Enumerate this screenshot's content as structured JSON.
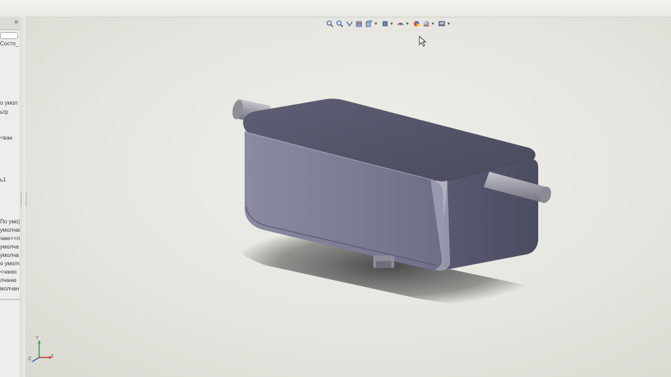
{
  "window": {
    "background_color": "#e7e6e0"
  },
  "feature_tree": {
    "collapse_label": "»",
    "lines": [
      "_Состо",
      "о умол",
      "ьтр",
      "ван>",
      "ь1",
      "(По умо",
      "умолчан",
      "чаю<<п",
      "умолча",
      "умолча",
      "о умолч",
      "чаню>",
      "лчаню",
      "молчан"
    ]
  },
  "heads_up_toolbar": {
    "buttons": [
      {
        "icon": "zoom-to-fit-icon"
      },
      {
        "icon": "zoom-to-area-icon"
      },
      {
        "icon": "previous-view-icon"
      },
      {
        "icon": "section-view-icon"
      },
      {
        "icon": "view-orientation-icon",
        "has_dropdown": true
      },
      {
        "icon": "display-style-icon",
        "has_dropdown": true
      },
      {
        "icon": "hide-show-items-icon",
        "has_dropdown": true
      },
      {
        "icon": "edit-appearance-icon"
      },
      {
        "icon": "apply-scene-icon",
        "has_dropdown": true
      },
      {
        "icon": "view-settings-icon",
        "has_dropdown": true
      }
    ],
    "dropdown_glyph": "▾"
  },
  "model": {
    "body_color": "#6a6b84",
    "pipe_color": "#9a9aa4",
    "shadow_color": "#3a3a3a"
  },
  "triad": {
    "x_label": "X",
    "y_label": "Y",
    "z_label": "Z"
  }
}
